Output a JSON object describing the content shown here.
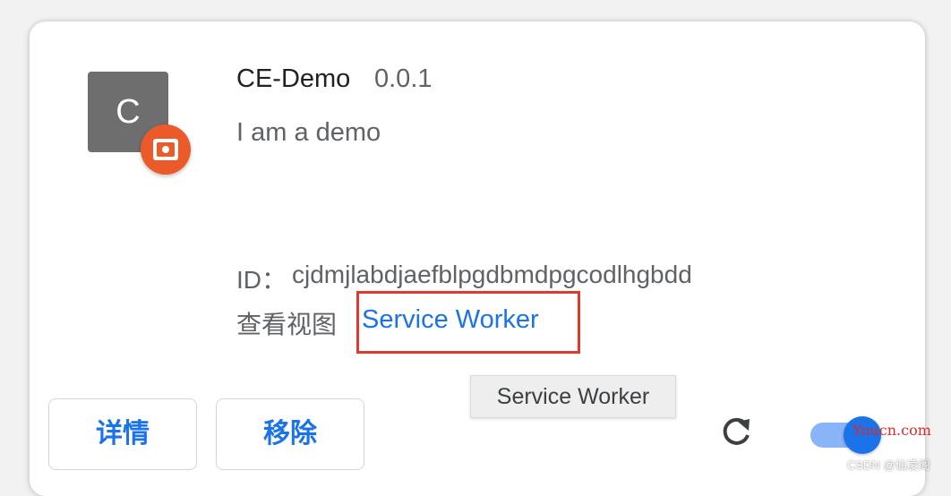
{
  "extension": {
    "icon_letter": "C",
    "name": "CE-Demo",
    "version": "0.0.1",
    "description": "I am a demo",
    "id_label": "ID：",
    "id_value": "cjdmjlabdjaefblpgdbmdpgcodlhgbdd",
    "views_label": "查看视图",
    "service_worker_link": "Service Worker",
    "tooltip": "Service Worker",
    "enabled": true
  },
  "actions": {
    "details_label": "详情",
    "remove_label": "移除"
  },
  "icons": {
    "extension": "extension-logo-icon",
    "badge": "unpacked-extension-badge-icon",
    "reload": "reload-icon"
  },
  "colors": {
    "accent": "#1a73e8",
    "highlight_box": "#e03a2e",
    "badge": "#ec5a2a"
  },
  "watermarks": {
    "site": "Yuucn.com",
    "source": "CSDN @仙凌阁"
  }
}
